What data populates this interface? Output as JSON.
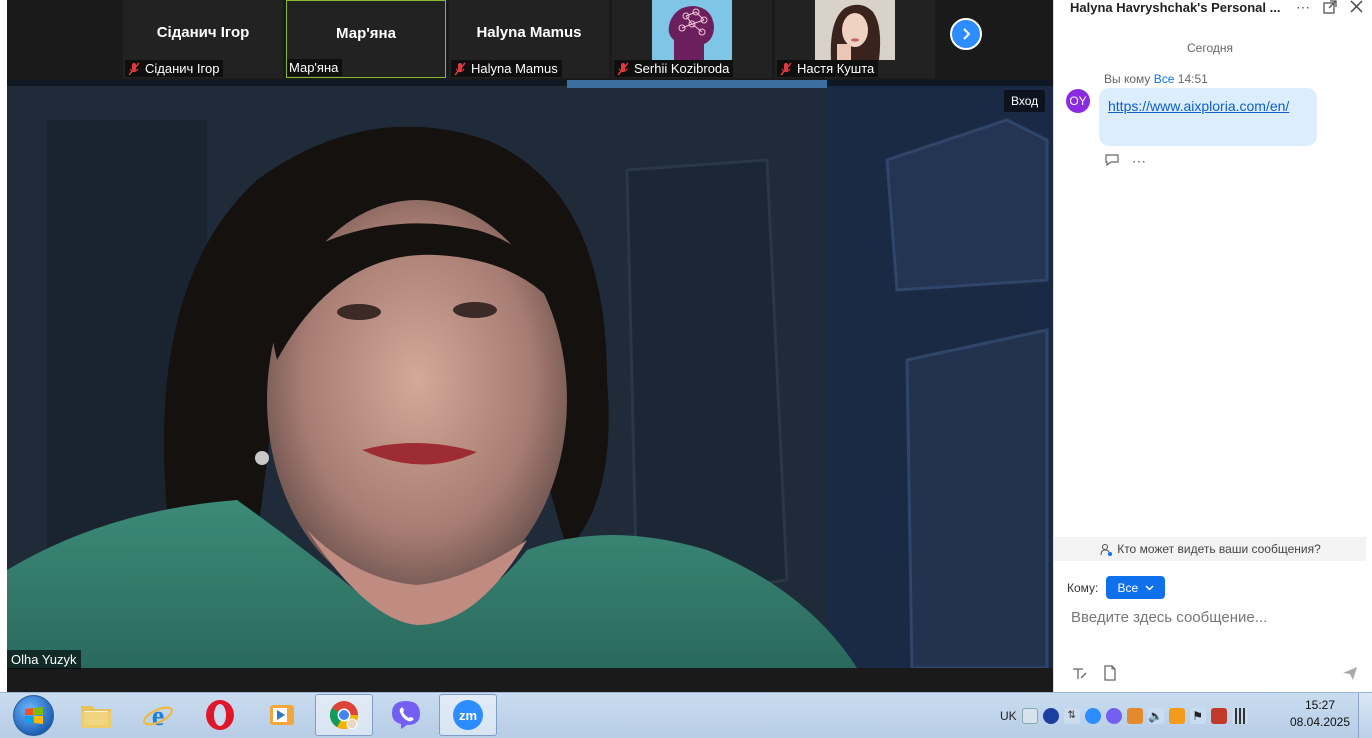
{
  "strip": {
    "tiles": [
      {
        "big": "Сіданич Ігор",
        "caption": "Сіданич Ігор"
      },
      {
        "big": "Мар'яна",
        "caption": "Мар'яна"
      },
      {
        "big": "Halyna Mamus",
        "caption": "Halyna Mamus"
      },
      {
        "big": "",
        "caption": "Serhii Kozibroda"
      },
      {
        "big": "",
        "caption": "Настя Кушта"
      }
    ]
  },
  "video": {
    "speaker_name": "Olha Yuzyk",
    "enter_label": "Вход"
  },
  "chat": {
    "title": "Halyna Havryshchak's Personal ...",
    "day_label": "Сегодня",
    "message": {
      "avatar": "OY",
      "meta_prefix": "Вы кому",
      "meta_to": "Все",
      "time": "14:51",
      "link": "https://www.aixploria.com/en/"
    },
    "who_can_see": "Кто может видеть ваши сообщения?",
    "to_label": "Кому:",
    "to_value": "Все",
    "input_placeholder": "Введите здесь сообщение..."
  },
  "taskbar": {
    "lang": "UK",
    "time": "15:27",
    "date": "08.04.2025"
  },
  "colors": {
    "accent_blue": "#0e71eb",
    "active_tile_border": "#8ab833",
    "avatar_purple": "#8a2be2",
    "bubble_bg": "#dceefd"
  }
}
